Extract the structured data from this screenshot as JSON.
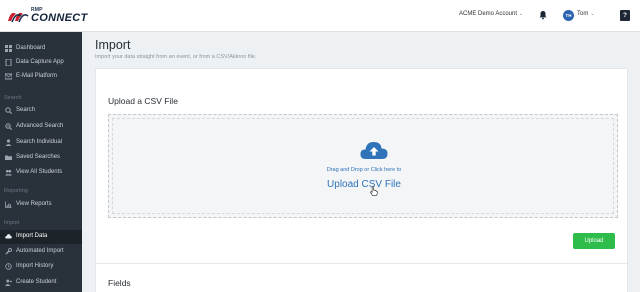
{
  "brand": {
    "small": "RMP",
    "name": "CONNECT"
  },
  "header": {
    "account": "ACME Demo Account",
    "user_initials": "TH",
    "user_name": "Tom",
    "help": "?"
  },
  "sidebar": {
    "items_top": [
      {
        "label": "Dashboard",
        "icon": "dashboard-icon"
      },
      {
        "label": "Data Capture App",
        "icon": "tablet-icon"
      },
      {
        "label": "E-Mail Platform",
        "icon": "envelope-icon"
      }
    ],
    "section_search": "Search",
    "items_search": [
      {
        "label": "Search",
        "icon": "search-icon"
      },
      {
        "label": "Advanced Search",
        "icon": "search-plus-icon"
      },
      {
        "label": "Search Individual",
        "icon": "user-icon"
      },
      {
        "label": "Saved Searches",
        "icon": "folder-icon"
      },
      {
        "label": "View All Students",
        "icon": "users-icon"
      }
    ],
    "section_reporting": "Reporting",
    "items_reporting": [
      {
        "label": "View Reports",
        "icon": "chart-icon"
      }
    ],
    "section_import": "Import",
    "items_import": [
      {
        "label": "Import Data",
        "icon": "cloud-upload-icon",
        "active": true
      },
      {
        "label": "Automated Import",
        "icon": "wrench-icon"
      },
      {
        "label": "Import History",
        "icon": "history-icon"
      },
      {
        "label": "Create Student",
        "icon": "user-plus-icon"
      }
    ]
  },
  "main": {
    "title": "Import",
    "subtitle": "Import your data straight from an event, or from a CSV/Akkroo file.",
    "upload_title": "Upload a CSV File",
    "drop_hint": "Drag and Drop or Click here to",
    "drop_link": "Upload CSV File",
    "upload_button": "Upload",
    "fields_title": "Fields"
  },
  "colors": {
    "sidebar": "#29313a",
    "accent_blue": "#2f73b8",
    "upload_green": "#2ebd4a"
  }
}
